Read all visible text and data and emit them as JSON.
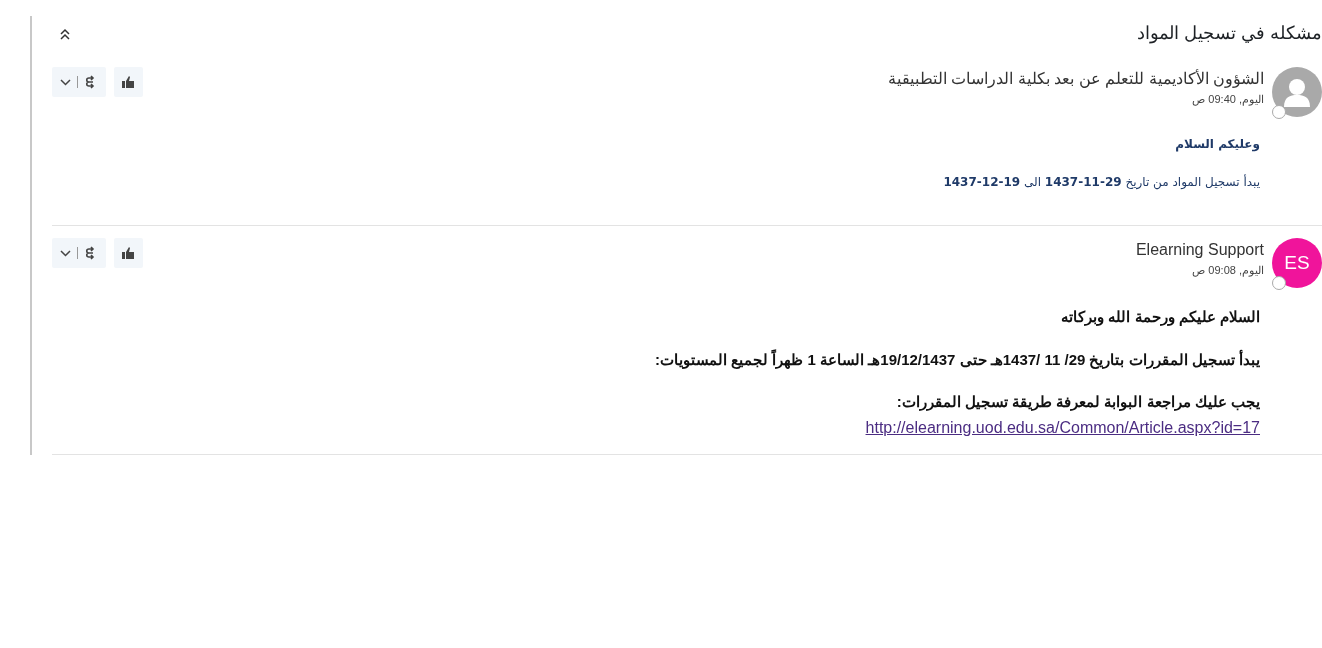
{
  "discussion": {
    "title": "مشكله في تسجيل المواد"
  },
  "posts": [
    {
      "author": "الشؤون الأكاديمية للتعلم عن بعد بكلية الدراسات التطبيقية",
      "time": "اليوم, 09:40 ص",
      "avatar": {
        "kind": "silhouette"
      },
      "paragraphs": [
        {
          "kind": "note",
          "bold": true,
          "text": "وعليكم السلام"
        },
        {
          "kind": "note",
          "bold": false,
          "text": "يبدأ تسجيل المواد من تاريخ **29-11-1437** الى **19-12-1437**"
        }
      ]
    },
    {
      "author": "Elearning Support",
      "time": "اليوم, 09:08 ص",
      "avatar": {
        "kind": "initials",
        "initials": "ES",
        "color": "#f0149b"
      },
      "paragraphs": [
        {
          "kind": "body",
          "bold": true,
          "text": "السلام عليكم ورحمة الله وبركاته"
        },
        {
          "kind": "body",
          "bold": true,
          "text": "يبدأ تسجيل المقررات بتاريخ 29/ 11 /1437هـ حتى 19/12/1437هـ الساعة 1 ظهراً لجميع المستويات:"
        },
        {
          "kind": "body",
          "bold": true,
          "text": "يجب عليك مراجعة البوابة لمعرفة طريقة تسجيل المقررات:"
        },
        {
          "kind": "link",
          "bold": false,
          "text": "http://elearning.uod.edu.sa/Common/Article.aspx?id=17"
        }
      ]
    }
  ]
}
